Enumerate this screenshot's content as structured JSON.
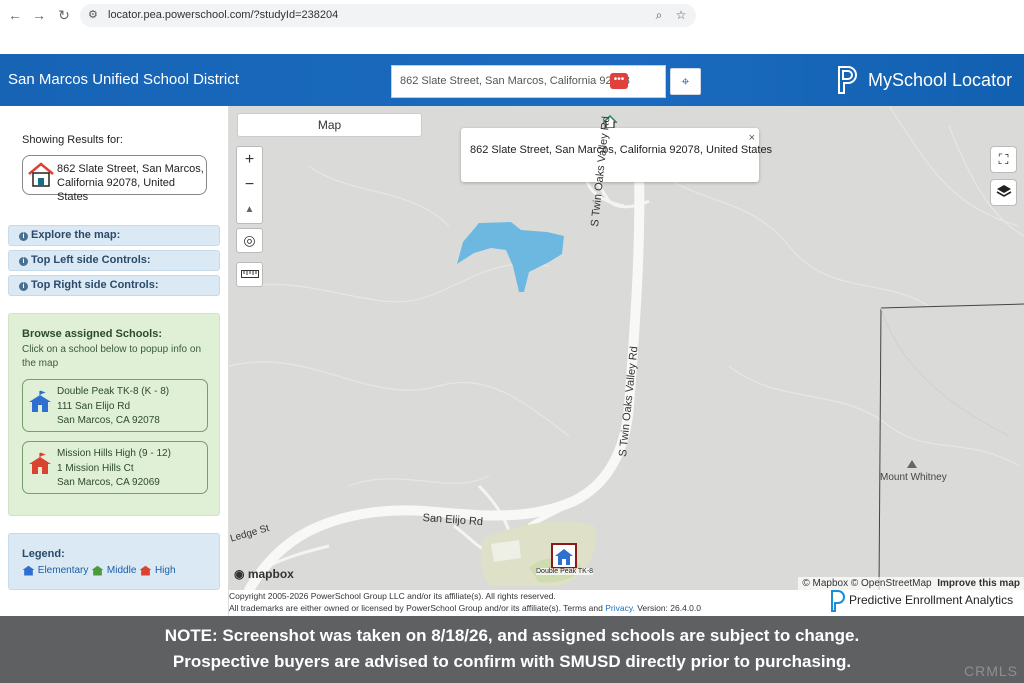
{
  "browser": {
    "url": "locator.pea.powerschool.com/?studyId=238204",
    "icons": [
      "back-icon",
      "forward-icon",
      "reload-icon",
      "site-settings-icon",
      "zoom-icon",
      "bookmark-star-icon"
    ]
  },
  "header": {
    "district_name": "San Marcos Unified School District",
    "address_value": "862 Slate Street, San Marcos, California 92078",
    "dots_label": "•••",
    "brand_name": "MySchool Locator",
    "colors": {
      "header_blue": "#1a6bc0",
      "dots_red": "#e0413a"
    }
  },
  "sidebar": {
    "showing_title": "Showing Results for:",
    "showing_address_line1": "862 Slate Street, San Marcos,",
    "showing_address_line2": "California 92078, United States",
    "accordions": [
      {
        "label": "Explore the map:"
      },
      {
        "label": "Top Left side Controls:"
      },
      {
        "label": "Top Right side Controls:"
      }
    ],
    "browse_title": "Browse assigned Schools:",
    "browse_sub": "Click on a school below to popup info on the map",
    "schools": [
      {
        "name": "Double Peak TK-8 (K - 8)",
        "street": "111 San Elijo Rd",
        "city": "San Marcos, CA 92078",
        "color": "#2f6fd0"
      },
      {
        "name": "Mission Hills High (9 - 12)",
        "street": "1 Mission Hills Ct",
        "city": "San Marcos, CA 92069",
        "color": "#d9432f"
      }
    ],
    "legend_title": "Legend:",
    "legend": [
      {
        "label": "Elementary",
        "color": "#2f6fd0"
      },
      {
        "label": "Middle",
        "color": "#4c9a3a"
      },
      {
        "label": "High",
        "color": "#d9432f"
      }
    ]
  },
  "map": {
    "tab_label": "Map",
    "zoom_in": "+",
    "zoom_out": "−",
    "compass": "▲",
    "popup_text": "862 Slate Street, San Marcos, California 92078, United States",
    "popup_close": "×",
    "road_labels": {
      "twin_oaks_upper": "S Twin Oaks Valley Rd",
      "twin_oaks_lower": "S Twin Oaks Valley Rd",
      "san_elijo": "San Elijo Rd",
      "ledge": "Ledge St"
    },
    "mountain": "Mount Whitney",
    "school_marker_label": "Double Peak TK-8",
    "mapbox_logo": "mapbox",
    "attribution_a": "© Mapbox © OpenStreetMap",
    "attribution_b": "Improve this map"
  },
  "footer": {
    "line1": "Copyright 2005-2026 PowerSchool Group LLC and/or its affiliate(s). All rights reserved.",
    "line2_a": "All trademarks are either owned or licensed by PowerSchool Group and/or its affiliate(s). Terms and ",
    "line2_link": "Privacy.",
    "line2_b": " Version: 26.4.0.0",
    "pea_name": "Predictive Enrollment Analytics"
  },
  "note": {
    "line1": "NOTE: Screenshot was taken on 8/18/26, and assigned schools are subject to change.",
    "line2": "Prospective buyers are advised to confirm with SMUSD directly prior to purchasing.",
    "watermark": "CRMLS"
  }
}
